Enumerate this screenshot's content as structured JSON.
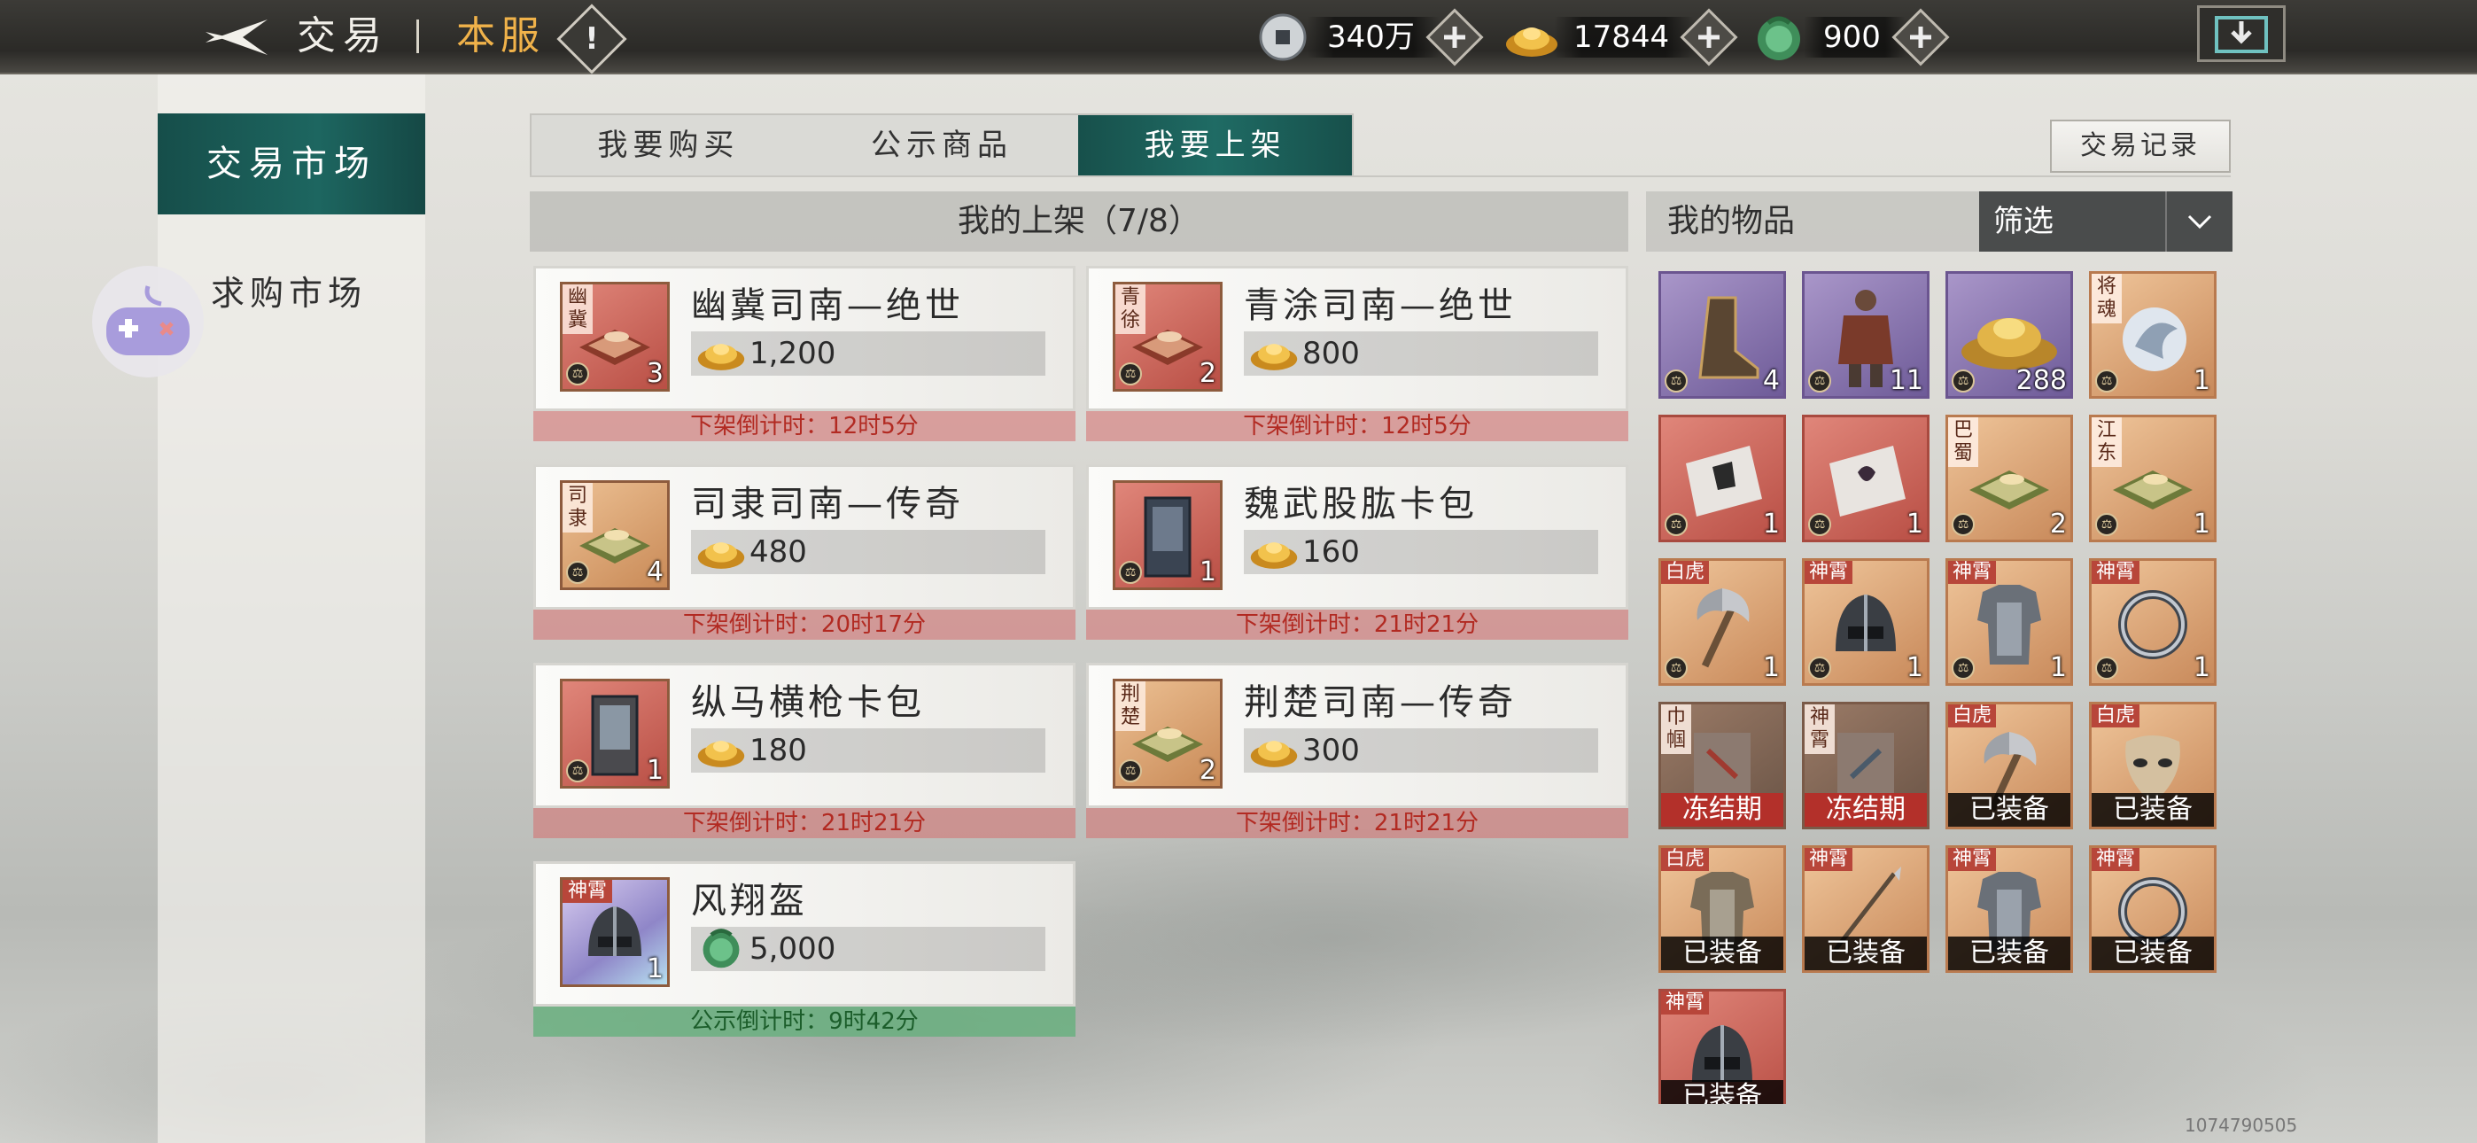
{
  "topbar": {
    "back_icon": "back-arrow-icon",
    "title": "交易",
    "server": "本服",
    "info_icon": "exclamation-icon",
    "currencies": [
      {
        "icon": "silver-coin-icon",
        "value": "340万"
      },
      {
        "icon": "gold-ingot-icon",
        "value": "17844"
      },
      {
        "icon": "jade-dragon-icon",
        "value": "900"
      }
    ],
    "download_icon": "download-icon"
  },
  "sidebar": {
    "items": [
      {
        "label": "交易市场",
        "active": true
      },
      {
        "label": "求购市场",
        "active": false
      }
    ],
    "controller_icon": "gamepad-icon"
  },
  "tabs": [
    {
      "label": "我要购买"
    },
    {
      "label": "公示商品"
    },
    {
      "label": "我要上架",
      "active": true
    }
  ],
  "record_button": "交易记录",
  "listings": {
    "header": "我的上架（7/8）",
    "items": [
      {
        "name": "幽冀司南—绝世",
        "price": "1,200",
        "currency": "gold-ingot",
        "tag": "幽冀",
        "count": "3",
        "timer": "下架倒计时：12时5分",
        "status": "red"
      },
      {
        "name": "青涂司南—绝世",
        "price": "800",
        "currency": "gold-ingot",
        "tag": "青徐",
        "count": "2",
        "timer": "下架倒计时：12时5分",
        "status": "red"
      },
      {
        "name": "司隶司南—传奇",
        "price": "480",
        "currency": "gold-ingot",
        "tag": "司隶",
        "count": "4",
        "timer": "下架倒计时：20时17分",
        "status": "red"
      },
      {
        "name": "魏武股肱卡包",
        "price": "160",
        "currency": "gold-ingot",
        "tag": "",
        "count": "1",
        "timer": "下架倒计时：21时21分",
        "status": "red"
      },
      {
        "name": "纵马横枪卡包",
        "price": "180",
        "currency": "gold-ingot",
        "tag": "",
        "count": "1",
        "timer": "下架倒计时：21时21分",
        "status": "red"
      },
      {
        "name": "荆楚司南—传奇",
        "price": "300",
        "currency": "gold-ingot",
        "tag": "荆楚",
        "count": "2",
        "timer": "下架倒计时：21时21分",
        "status": "red"
      },
      {
        "name": "风翔盔",
        "price": "5,000",
        "currency": "jade-dragon",
        "tag": "神霄",
        "count": "1",
        "timer": "公示倒计时：9时42分",
        "status": "green"
      }
    ]
  },
  "inventory": {
    "header": "我的物品",
    "filter": "筛选",
    "slots": [
      {
        "icon": "boot-icon",
        "count": "4",
        "tag": ""
      },
      {
        "icon": "armor-figure-icon",
        "count": "11",
        "tag": ""
      },
      {
        "icon": "gold-pile-icon",
        "count": "288",
        "tag": ""
      },
      {
        "icon": "soul-orb-icon",
        "count": "1",
        "tag": "将魂"
      },
      {
        "icon": "scroll-icon",
        "count": "1",
        "tag": ""
      },
      {
        "icon": "scroll-icon",
        "count": "1",
        "tag": ""
      },
      {
        "icon": "compass-icon",
        "count": "2",
        "tag": "巴蜀"
      },
      {
        "icon": "compass-icon",
        "count": "1",
        "tag": "江东"
      },
      {
        "icon": "axe-icon",
        "count": "1",
        "tag": "白虎"
      },
      {
        "icon": "helmet-icon",
        "count": "1",
        "tag": "神霄"
      },
      {
        "icon": "armor-icon",
        "count": "1",
        "tag": "神霄"
      },
      {
        "icon": "ring-icon",
        "count": "1",
        "tag": "神霄"
      },
      {
        "icon": "scroll-icon",
        "count": "",
        "tag": "巾帼",
        "state": "冻结期"
      },
      {
        "icon": "scroll-icon",
        "count": "",
        "tag": "神霄",
        "state": "冻结期"
      },
      {
        "icon": "axe-icon",
        "count": "",
        "tag": "白虎",
        "state": "已装备"
      },
      {
        "icon": "mask-icon",
        "count": "",
        "tag": "白虎",
        "state": "已装备"
      },
      {
        "icon": "armor-icon",
        "count": "",
        "tag": "白虎",
        "state": "已装备"
      },
      {
        "icon": "spear-icon",
        "count": "",
        "tag": "神霄",
        "state": "已装备"
      },
      {
        "icon": "armor-icon",
        "count": "",
        "tag": "神霄",
        "state": "已装备"
      },
      {
        "icon": "ring-icon",
        "count": "",
        "tag": "神霄",
        "state": "已装备"
      },
      {
        "icon": "helmet-icon",
        "count": "",
        "tag": "神霄",
        "state": "已装备"
      }
    ]
  },
  "watermark": "1074790505",
  "colors": {
    "accent_teal": "#1d6660",
    "gold_text": "#f0b24a",
    "timer_red": "#b22a22",
    "timer_green": "#1b5d2a"
  }
}
